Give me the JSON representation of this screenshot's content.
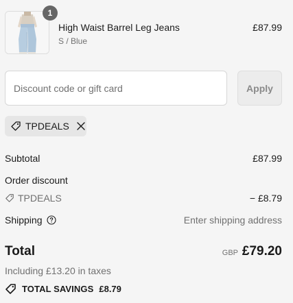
{
  "line_item": {
    "quantity": "1",
    "name": "High Waist Barrel Leg Jeans",
    "variant": "S / Blue",
    "price": "£87.99"
  },
  "discount": {
    "placeholder": "Discount code or gift card",
    "value": "",
    "apply_label": "Apply"
  },
  "applied_code": {
    "code": "TPDEALS",
    "icon": "tag-icon",
    "remove_icon": "close-icon"
  },
  "summary": {
    "subtotal_label": "Subtotal",
    "subtotal_value": "£87.99",
    "order_discount_label": "Order discount",
    "order_discount_code": "TPDEALS",
    "order_discount_value": "− £8.79",
    "shipping_label": "Shipping",
    "shipping_info_icon": "help-circle-icon",
    "shipping_value": "Enter shipping address"
  },
  "total": {
    "label": "Total",
    "currency": "GBP",
    "value": "£79.20",
    "tax_note": "Including £13.20 in taxes"
  },
  "savings": {
    "label": "TOTAL SAVINGS",
    "value": "£8.79",
    "icon": "savings-tag-icon"
  },
  "colors": {
    "background": "#f5f5f5",
    "text": "#1a1a1a",
    "muted": "#707070",
    "badge": "#666666",
    "chip": "#e6e6e6"
  }
}
